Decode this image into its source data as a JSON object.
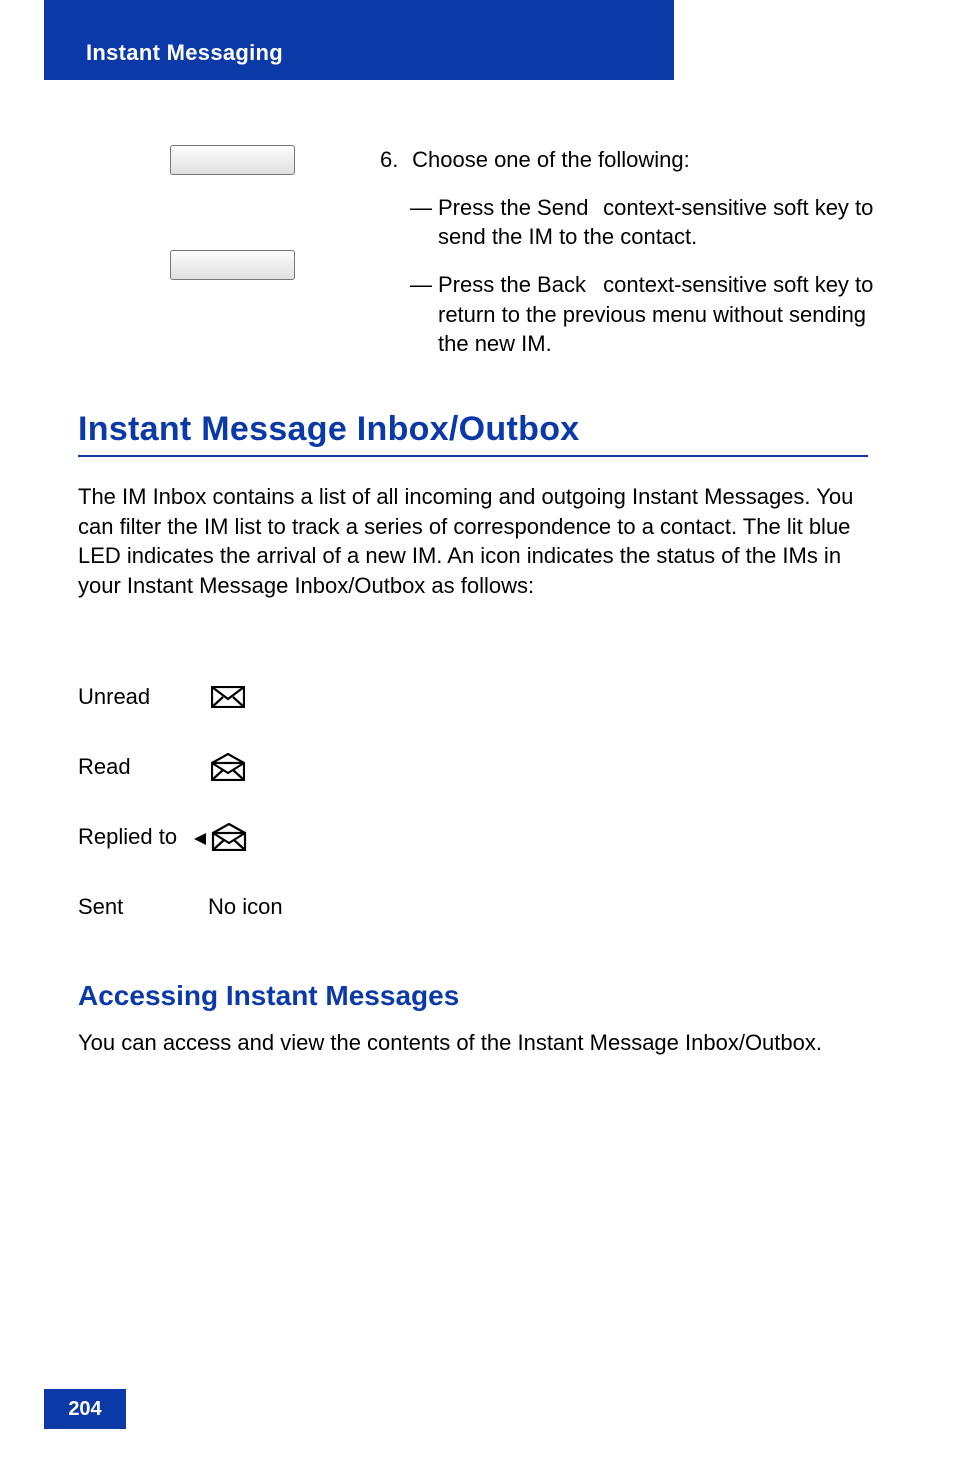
{
  "header": {
    "section_title": "Instant Messaging"
  },
  "step": {
    "number": "6.",
    "intro": "Choose one of the following:",
    "items": [
      {
        "prefix": "Press the ",
        "key_name": "Send",
        "suffix": " context-sensitive soft key to send the IM to the contact."
      },
      {
        "prefix": "Press the ",
        "key_name": "Back",
        "suffix": " context-sensitive soft key to return to the previous menu without sending the new IM."
      }
    ]
  },
  "h1": "Instant Message Inbox/Outbox",
  "body": "The IM Inbox contains a list of all incoming and outgoing Instant Messages. You can filter the IM list to track a series of correspondence to a contact. The lit blue LED indicates the arrival of a new IM. An icon indicates the status of the IMs in your Instant Message Inbox/Outbox as follows:",
  "statuses": [
    {
      "label": "Unread",
      "icon": "envelope-closed-icon"
    },
    {
      "label": "Read",
      "icon": "envelope-open-icon"
    },
    {
      "label": "Replied to",
      "icon": "envelope-reply-icon"
    },
    {
      "label": "Sent",
      "icon_text": "No icon"
    }
  ],
  "h2": "Accessing Instant Messages",
  "h2_body": "You can access and view the contents of the Instant Message Inbox/Outbox.",
  "page_number": "204"
}
